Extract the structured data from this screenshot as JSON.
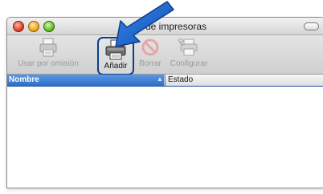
{
  "window": {
    "title_visible": "de impresoras"
  },
  "toolbar": {
    "default_label": "Usar por omisión",
    "add_label": "Añadir",
    "delete_label": "Borrar",
    "configure_label": "Configurar"
  },
  "table": {
    "columns": [
      "Nombre",
      "Estado"
    ],
    "sort_indicator": "▲",
    "rows": []
  },
  "colors": {
    "header_blue": "#2d6fc8",
    "arrow_blue": "#1a5fc4",
    "highlight_border": "#0a3f8a"
  },
  "icons": [
    "printer-icon",
    "add-printer-icon",
    "delete-icon",
    "configure-icon",
    "pointer-arrow-icon"
  ]
}
